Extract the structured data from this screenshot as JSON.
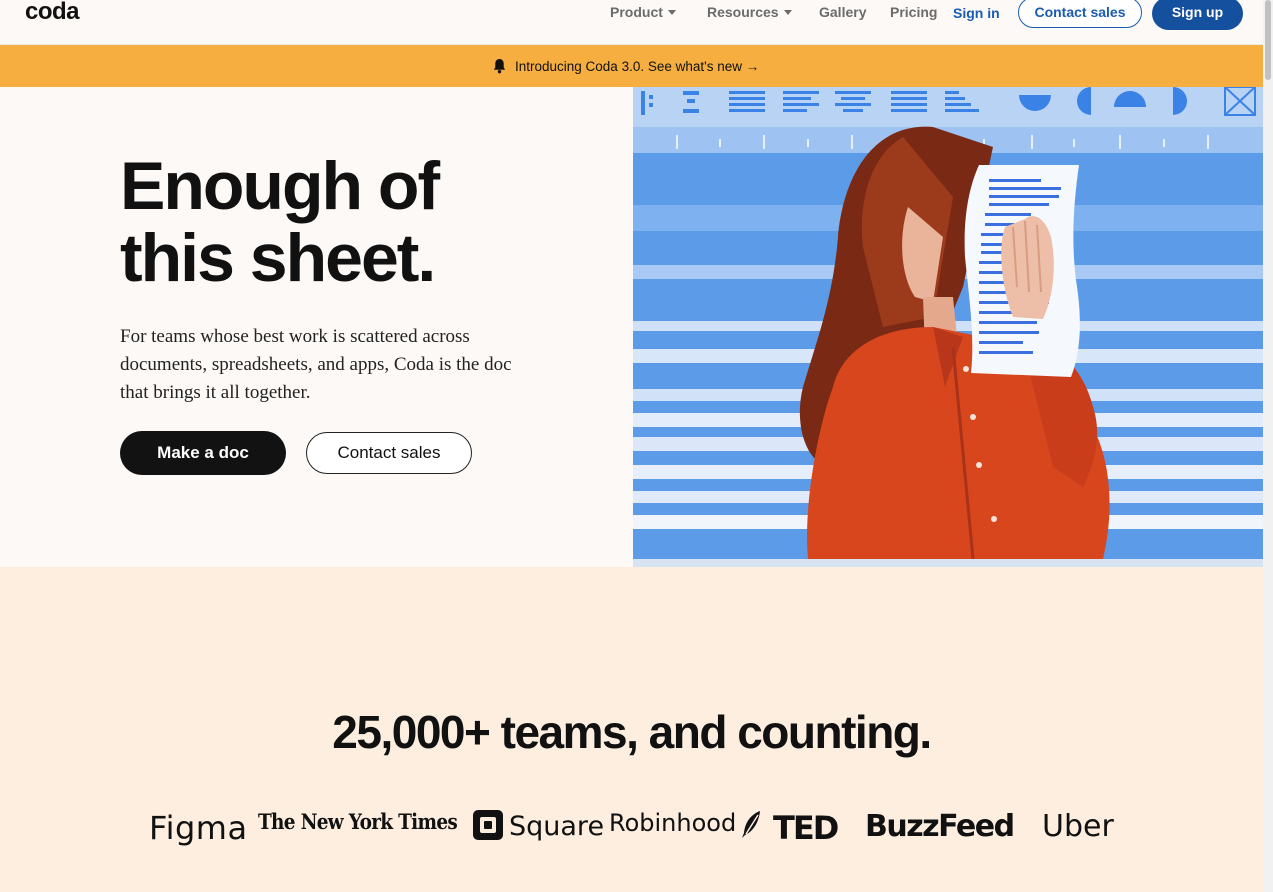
{
  "nav": {
    "logo": "coda",
    "product": "Product",
    "resources": "Resources",
    "gallery": "Gallery",
    "pricing": "Pricing",
    "sign_in": "Sign in",
    "contact_sales": "Contact sales",
    "sign_up": "Sign up"
  },
  "banner": {
    "text": "Introducing Coda 3.0. See what's new →",
    "icon": "bell-icon"
  },
  "hero": {
    "headline_line1": "Enough of",
    "headline_line2": "this sheet.",
    "subtitle": "For teams whose best work is scattered across documents, spreadsheets, and apps, Coda is the doc that brings it all together.",
    "primary_cta": "Make a doc",
    "secondary_cta": "Contact sales"
  },
  "teams": {
    "title": "25,000+ teams, and counting.",
    "logos": [
      "Figma",
      "The New York Times",
      "Square",
      "Robinhood",
      "TED",
      "BuzzFeed",
      "Uber"
    ]
  },
  "colors": {
    "banner": "#f6ae40",
    "brand_blue": "#15509e",
    "hero_bg": "#fcf9f6",
    "teams_bg": "#fdeee0",
    "image_blue": "#5b9be8",
    "shirt": "#d8461e"
  }
}
